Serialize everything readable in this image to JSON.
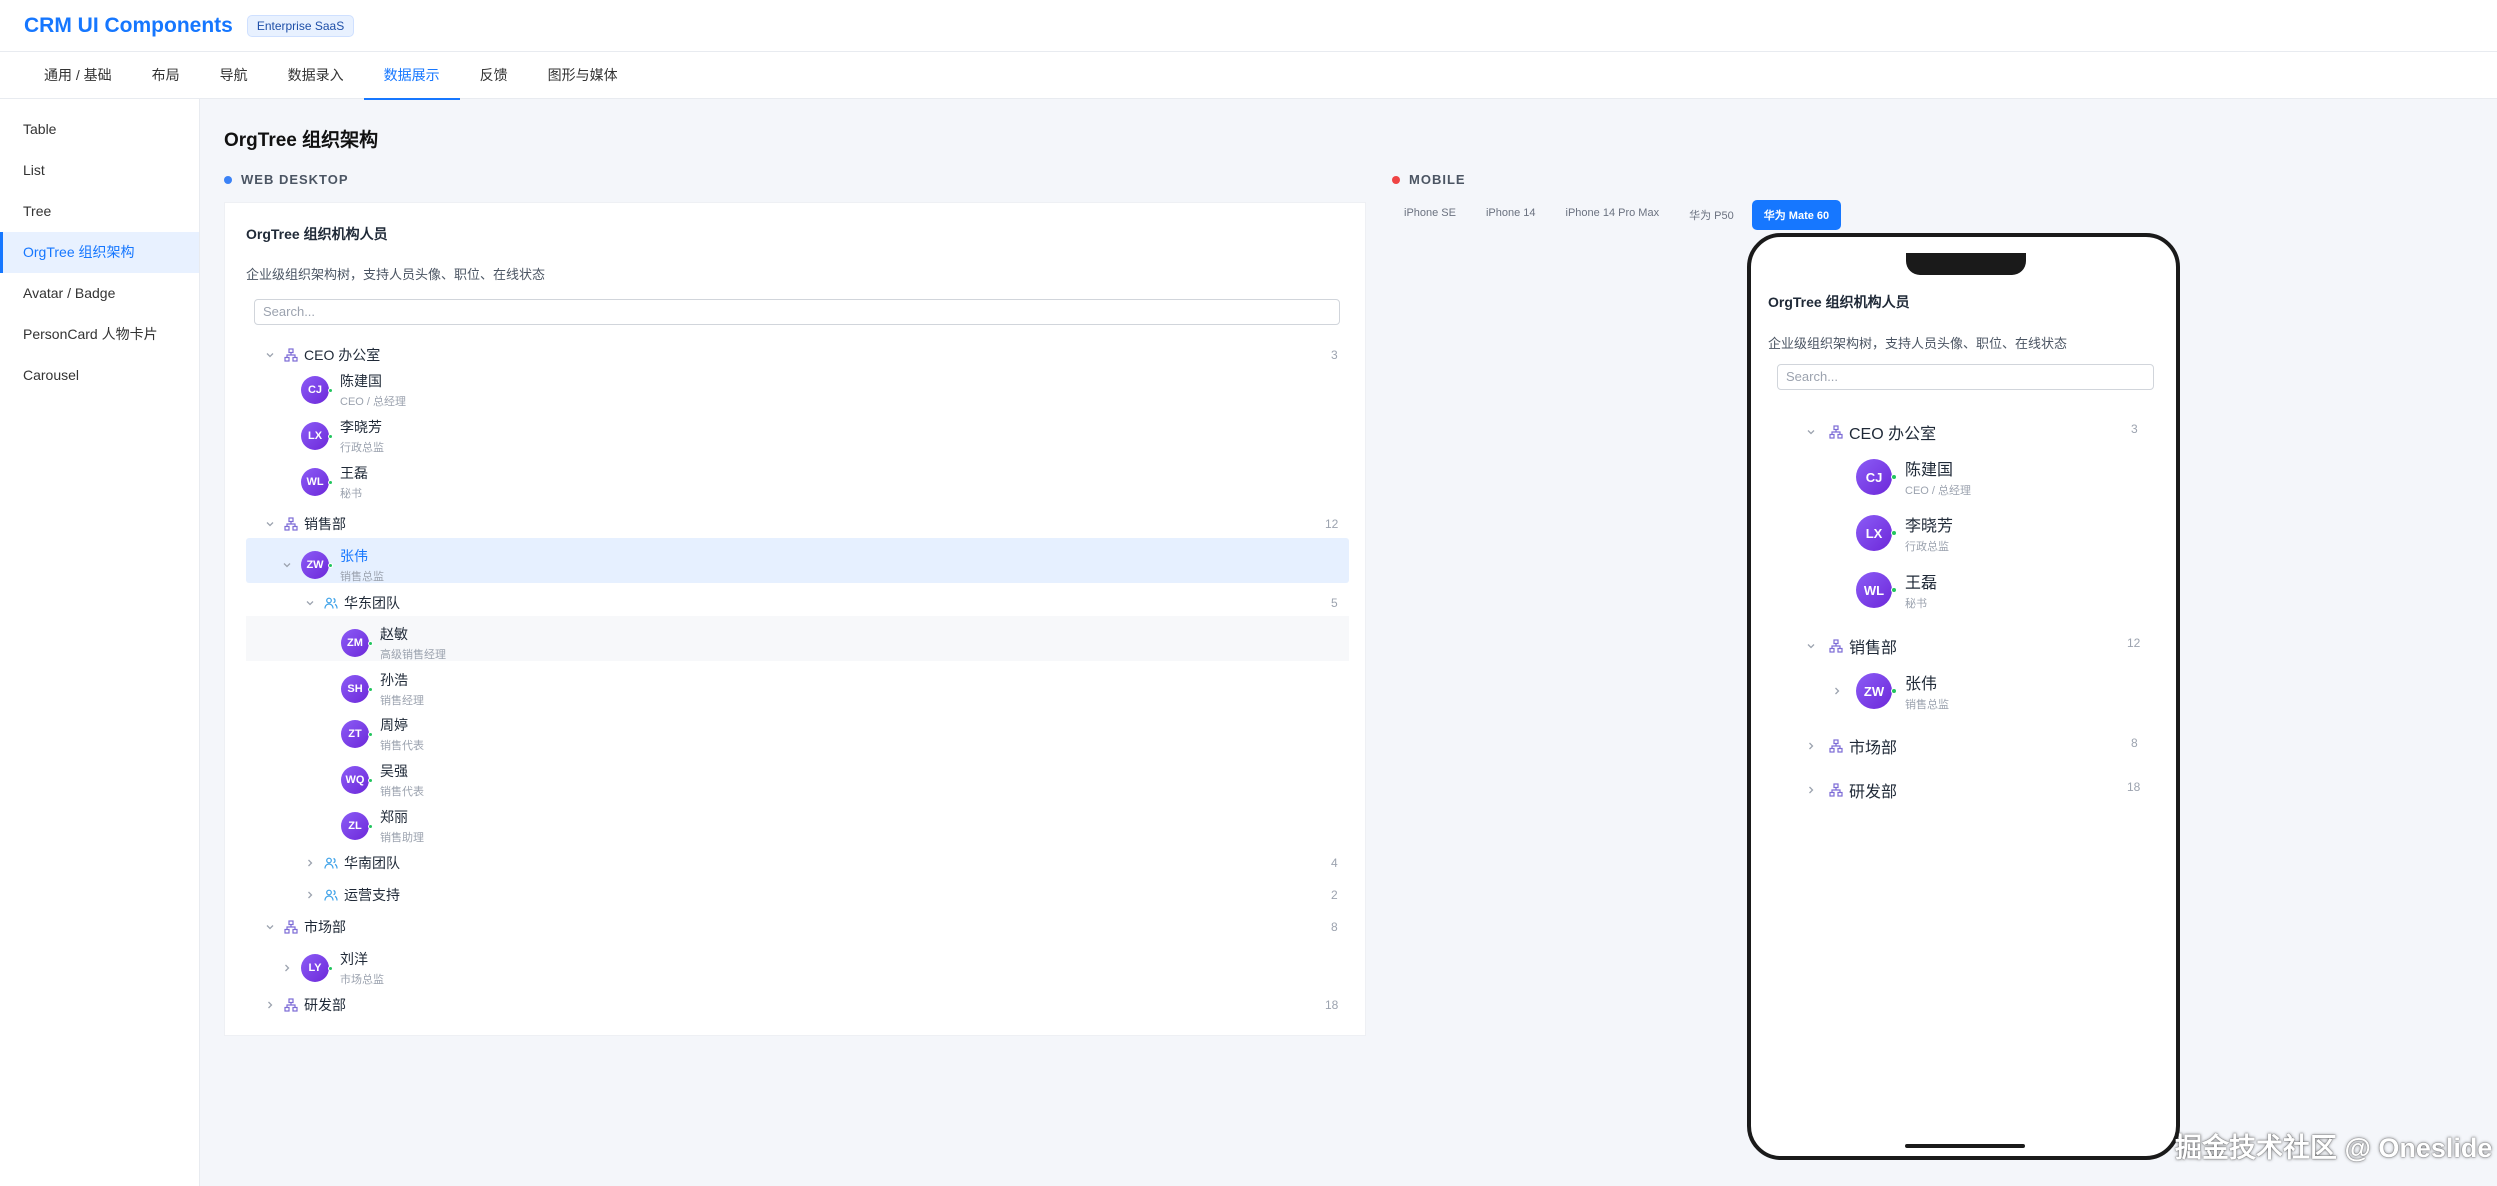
{
  "header": {
    "title": "CRM UI Components",
    "badge": "Enterprise SaaS"
  },
  "tabs": [
    {
      "label": "通用 / 基础"
    },
    {
      "label": "布局"
    },
    {
      "label": "导航"
    },
    {
      "label": "数据录入"
    },
    {
      "label": "数据展示",
      "active": true
    },
    {
      "label": "反馈"
    },
    {
      "label": "图形与媒体"
    }
  ],
  "sidebar": {
    "items": [
      {
        "label": "Table"
      },
      {
        "label": "List"
      },
      {
        "label": "Tree"
      },
      {
        "label": "OrgTree 组织架构",
        "active": true
      },
      {
        "label": "Avatar / Badge"
      },
      {
        "label": "PersonCard 人物卡片"
      },
      {
        "label": "Carousel"
      }
    ]
  },
  "main": {
    "page_title": "OrgTree 组织架构",
    "desktop_label": "WEB DESKTOP",
    "mobile_label": "MOBILE"
  },
  "colors": {
    "accent": "#1677ff",
    "desktop_dot": "#3b82f6",
    "mobile_dot": "#ef4444",
    "online": "#22c55e",
    "avatar": "#7c3aed",
    "org_icon": "#7c6bd6",
    "team_icon": "#3aa0e8"
  },
  "card": {
    "title": "OrgTree 组织机构人员",
    "desc": "企业级组织架构树，支持人员头像、职位、在线状态",
    "search_placeholder": "Search..."
  },
  "desktop_tree": {
    "ceo": {
      "label": "CEO 办公室",
      "count": "3"
    },
    "ceo_people": [
      {
        "initials": "CJ",
        "name": "陈建国",
        "role": "CEO / 总经理"
      },
      {
        "initials": "LX",
        "name": "李晓芳",
        "role": "行政总监"
      },
      {
        "initials": "WL",
        "name": "王磊",
        "role": "秘书"
      }
    ],
    "sales": {
      "label": "销售部",
      "count": "12"
    },
    "sales_head": {
      "initials": "ZW",
      "name": "张伟",
      "role": "销售总监"
    },
    "east": {
      "label": "华东团队",
      "count": "5"
    },
    "east_people": [
      {
        "initials": "ZM",
        "name": "赵敏",
        "role": "高级销售经理"
      },
      {
        "initials": "SH",
        "name": "孙浩",
        "role": "销售经理"
      },
      {
        "initials": "ZT",
        "name": "周婷",
        "role": "销售代表"
      },
      {
        "initials": "WQ",
        "name": "吴强",
        "role": "销售代表"
      },
      {
        "initials": "ZL",
        "name": "郑丽",
        "role": "销售助理"
      }
    ],
    "south": {
      "label": "华南团队",
      "count": "4"
    },
    "ops": {
      "label": "运营支持",
      "count": "2"
    },
    "market": {
      "label": "市场部",
      "count": "8"
    },
    "market_head": {
      "initials": "LY",
      "name": "刘洋",
      "role": "市场总监"
    },
    "rd": {
      "label": "研发部",
      "count": "18"
    }
  },
  "devices": [
    {
      "label": "iPhone SE"
    },
    {
      "label": "iPhone 14"
    },
    {
      "label": "iPhone 14 Pro Max"
    },
    {
      "label": "华为 P50"
    },
    {
      "label": "华为 Mate 60",
      "active": true
    }
  ],
  "mobile_tree": {
    "ceo": {
      "label": "CEO 办公室",
      "count": "3"
    },
    "ceo_people": [
      {
        "initials": "CJ",
        "name": "陈建国",
        "role": "CEO / 总经理"
      },
      {
        "initials": "LX",
        "name": "李晓芳",
        "role": "行政总监"
      },
      {
        "initials": "WL",
        "name": "王磊",
        "role": "秘书"
      }
    ],
    "sales": {
      "label": "销售部",
      "count": "12"
    },
    "sales_head": {
      "initials": "ZW",
      "name": "张伟",
      "role": "销售总监"
    },
    "market": {
      "label": "市场部",
      "count": "8"
    },
    "rd": {
      "label": "研发部",
      "count": "18"
    }
  },
  "watermark": "掘金技术社区 @ Oneslide"
}
